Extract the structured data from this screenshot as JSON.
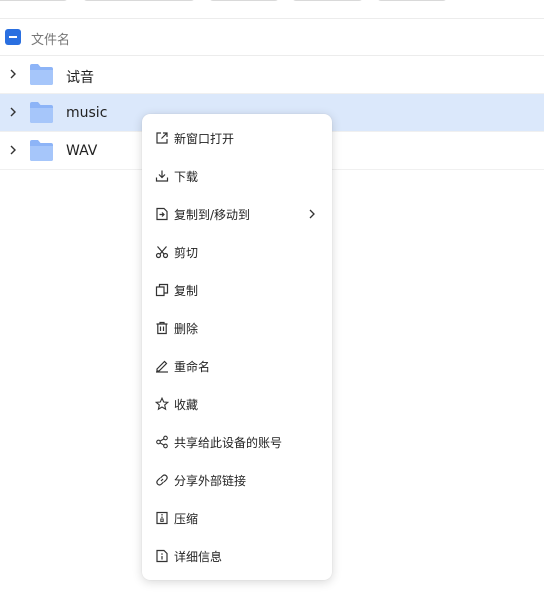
{
  "colors": {
    "accent": "#2a6fe0",
    "selected_row": "#dbe8fb",
    "folder": "#8db4f7"
  },
  "file_list": {
    "header_label": "文件名",
    "rows": [
      {
        "name": "试音",
        "icon": "folder-icon",
        "selected": false
      },
      {
        "name": "music",
        "icon": "folder-icon",
        "selected": true
      },
      {
        "name": "WAV",
        "icon": "folder-icon",
        "selected": false
      }
    ]
  },
  "context_menu": {
    "items": [
      {
        "label": "新窗口打开",
        "icon": "open-new-window-icon"
      },
      {
        "label": "下载",
        "icon": "download-icon"
      },
      {
        "label": "复制到/移动到",
        "icon": "copy-move-icon",
        "has_submenu": true
      },
      {
        "label": "剪切",
        "icon": "scissors-icon"
      },
      {
        "label": "复制",
        "icon": "copy-icon"
      },
      {
        "label": "删除",
        "icon": "trash-icon"
      },
      {
        "label": "重命名",
        "icon": "pencil-icon"
      },
      {
        "label": "收藏",
        "icon": "star-icon"
      },
      {
        "label": "共享给此设备的账号",
        "icon": "share-icon"
      },
      {
        "label": "分享外部链接",
        "icon": "link-icon"
      },
      {
        "label": "压缩",
        "icon": "archive-icon"
      },
      {
        "label": "详细信息",
        "icon": "info-icon"
      }
    ]
  }
}
